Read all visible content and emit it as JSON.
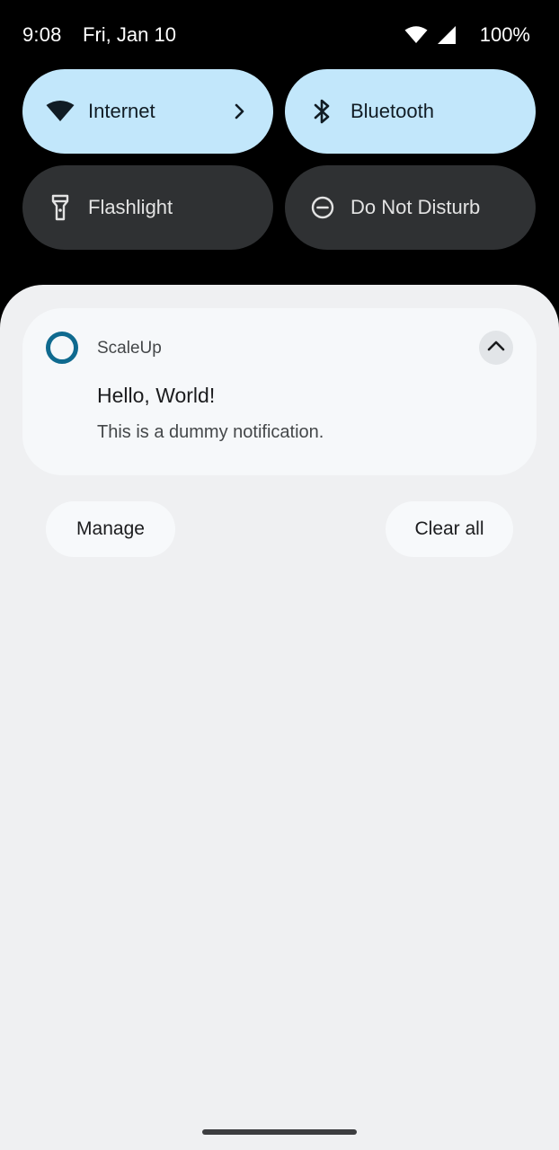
{
  "status_bar": {
    "time": "9:08",
    "date": "Fri, Jan 10",
    "battery": "100%",
    "icons": [
      "wifi-icon",
      "cell-signal-icon"
    ]
  },
  "quick_settings": {
    "tiles": [
      {
        "label": "Internet",
        "icon": "wifi-icon",
        "state": "on",
        "has_chevron": true
      },
      {
        "label": "Bluetooth",
        "icon": "bluetooth-icon",
        "state": "on"
      },
      {
        "label": "Flashlight",
        "icon": "flashlight-icon",
        "state": "off"
      },
      {
        "label": "Do Not Disturb",
        "icon": "do-not-disturb-icon",
        "state": "off"
      }
    ]
  },
  "notification": {
    "app_name": "ScaleUp",
    "app_icon": "ring-icon",
    "title": "Hello, World!",
    "text": "This is a dummy notification.",
    "expand_icon": "chevron-up-icon"
  },
  "actions": {
    "manage_label": "Manage",
    "clear_label": "Clear all"
  },
  "colors": {
    "tile_on": "#c2e7fb",
    "tile_off": "#2f3133",
    "shade_bg": "#eff0f2",
    "app_icon_accent": "#0f6a8f"
  }
}
